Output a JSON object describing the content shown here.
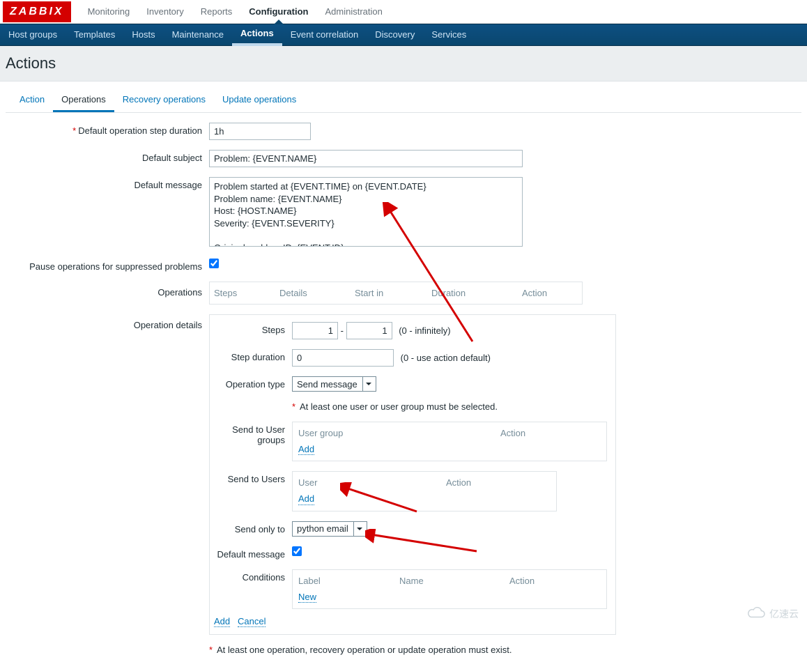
{
  "brand": "ZABBIX",
  "top_nav": [
    "Monitoring",
    "Inventory",
    "Reports",
    "Configuration",
    "Administration"
  ],
  "top_nav_active": 3,
  "sub_nav": [
    "Host groups",
    "Templates",
    "Hosts",
    "Maintenance",
    "Actions",
    "Event correlation",
    "Discovery",
    "Services"
  ],
  "sub_nav_active": 4,
  "page_title": "Actions",
  "tabs": [
    "Action",
    "Operations",
    "Recovery operations",
    "Update operations"
  ],
  "tabs_active": 1,
  "form": {
    "step_duration_label": "Default operation step duration",
    "step_duration_value": "1h",
    "default_subject_label": "Default subject",
    "default_subject_value": "Problem: {EVENT.NAME}",
    "default_message_label": "Default message",
    "default_message_value": "Problem started at {EVENT.TIME} on {EVENT.DATE}\nProblem name: {EVENT.NAME}\nHost: {HOST.NAME}\nSeverity: {EVENT.SEVERITY}\n\nOriginal problem ID: {EVENT.ID}\n{TRIGGER.URL}",
    "pause_label": "Pause operations for suppressed problems",
    "operations_label": "Operations",
    "operations_cols": [
      "Steps",
      "Details",
      "Start in",
      "Duration",
      "Action"
    ],
    "operation_details_label": "Operation details",
    "detail": {
      "steps_label": "Steps",
      "steps_from": "1",
      "steps_to": "1",
      "steps_hint": "(0 - infinitely)",
      "step_dur_label": "Step duration",
      "step_dur_value": "0",
      "step_dur_hint": "(0 - use action default)",
      "op_type_label": "Operation type",
      "op_type_value": "Send message",
      "user_warning": "At least one user or user group must be selected.",
      "send_groups_label": "Send to User groups",
      "groups_cols": [
        "User group",
        "Action"
      ],
      "send_users_label": "Send to Users",
      "users_cols": [
        "User",
        "Action"
      ],
      "send_only_label": "Send only to",
      "send_only_value": "python email",
      "default_msg_label": "Default message",
      "conditions_label": "Conditions",
      "conditions_cols": [
        "Label",
        "Name",
        "Action"
      ],
      "new_link": "New",
      "add_link": "Add"
    },
    "bottom_add": "Add",
    "bottom_cancel": "Cancel",
    "footer_note": "At least one operation, recovery operation or update operation must exist."
  },
  "watermark": "亿速云"
}
